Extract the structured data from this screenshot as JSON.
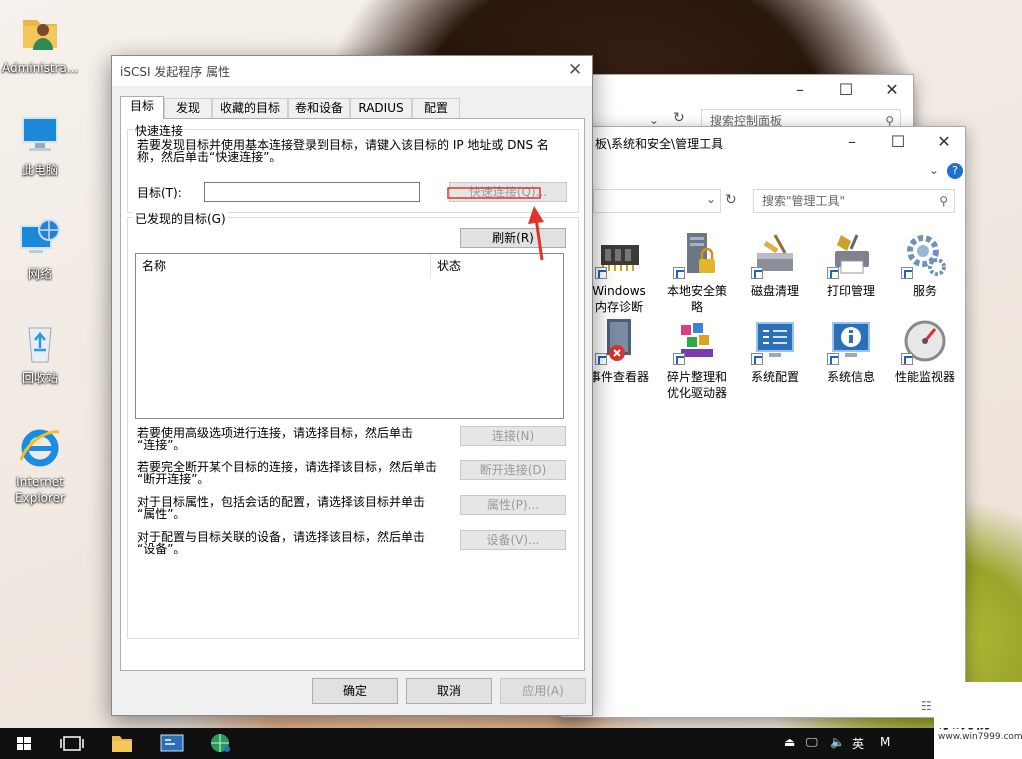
{
  "desktop": {
    "icons": [
      {
        "label": "Administra...",
        "icon": "user-folder-icon"
      },
      {
        "label": "此电脑",
        "icon": "computer-icon"
      },
      {
        "label": "网络",
        "icon": "network-icon"
      },
      {
        "label": "回收站",
        "icon": "recycle-bin-icon"
      },
      {
        "label_line1": "Internet",
        "label_line2": "Explorer",
        "icon": "internet-explorer-icon"
      }
    ]
  },
  "control_panel_window": {
    "search_placeholder": "搜索控制面板"
  },
  "admin_tools_window": {
    "breadcrumb": "板\\系统和安全\\管理工具",
    "search_placeholder": "搜索\"管理工具\"",
    "tools_row1": [
      {
        "label_line1": "Windows",
        "label_line2": "内存诊断",
        "icon": "memory-chip-icon"
      },
      {
        "label_line1": "本地安全策",
        "label_line2": "略",
        "icon": "security-policy-icon"
      },
      {
        "label_line1": "磁盘清理",
        "label_line2": "",
        "icon": "disk-cleanup-icon"
      },
      {
        "label_line1": "打印管理",
        "label_line2": "",
        "icon": "print-management-icon"
      },
      {
        "label_line1": "服务",
        "label_line2": "",
        "icon": "services-gear-icon"
      }
    ],
    "tools_row2": [
      {
        "label_line1": "事件查看器",
        "label_line2": "",
        "icon": "event-viewer-icon"
      },
      {
        "label_line1": "碎片整理和",
        "label_line2": "优化驱动器",
        "icon": "defrag-icon"
      },
      {
        "label_line1": "系统配置",
        "label_line2": "",
        "icon": "system-config-icon"
      },
      {
        "label_line1": "系统信息",
        "label_line2": "",
        "icon": "system-info-icon"
      },
      {
        "label_line1": "性能监视器",
        "label_line2": "",
        "icon": "performance-monitor-icon"
      }
    ]
  },
  "dialog": {
    "title": "iSCSI 发起程序 属性",
    "tabs": [
      "目标",
      "发现",
      "收藏的目标",
      "卷和设备",
      "RADIUS",
      "配置"
    ],
    "quick_connect": {
      "group_label": "快速连接",
      "description_line1": "若要发现目标并使用基本连接登录到目标，请键入该目标的 IP 地址或 DNS 名",
      "description_line2": "称，然后单击“快速连接”。",
      "target_label": "目标(T):",
      "target_value": "",
      "quick_connect_button": "快速连接(Q)..."
    },
    "discovered": {
      "group_label": "已发现的目标(G)",
      "refresh_button": "刷新(R)",
      "columns": [
        "名称",
        "状态"
      ],
      "rows": []
    },
    "actions": [
      {
        "text_line1": "若要使用高级选项进行连接，请选择目标，然后单击",
        "text_line2": "“连接”。",
        "button": "连接(N)"
      },
      {
        "text_line1": "若要完全断开某个目标的连接，请选择该目标，然后单击",
        "text_line2": "“断开连接”。",
        "button": "断开连接(D)"
      },
      {
        "text_line1": "对于目标属性，包括会话的配置，请选择该目标并单击",
        "text_line2": "“属性”。",
        "button": "属性(P)..."
      },
      {
        "text_line1": "对于配置与目标关联的设备，请选择该目标，然后单击",
        "text_line2": "“设备”。",
        "button": "设备(V)..."
      }
    ],
    "ok_button": "确定",
    "cancel_button": "取消",
    "apply_button": "应用(A)"
  },
  "taskbar": {
    "ime": "英",
    "ime_extra": "M",
    "watermark_brand": "系统粉",
    "watermark_url": "www.win7999.com"
  },
  "colors": {
    "annotation_red": "#e0342b",
    "taskbar": "#101010",
    "dialog_bg": "#f0f0f0"
  }
}
